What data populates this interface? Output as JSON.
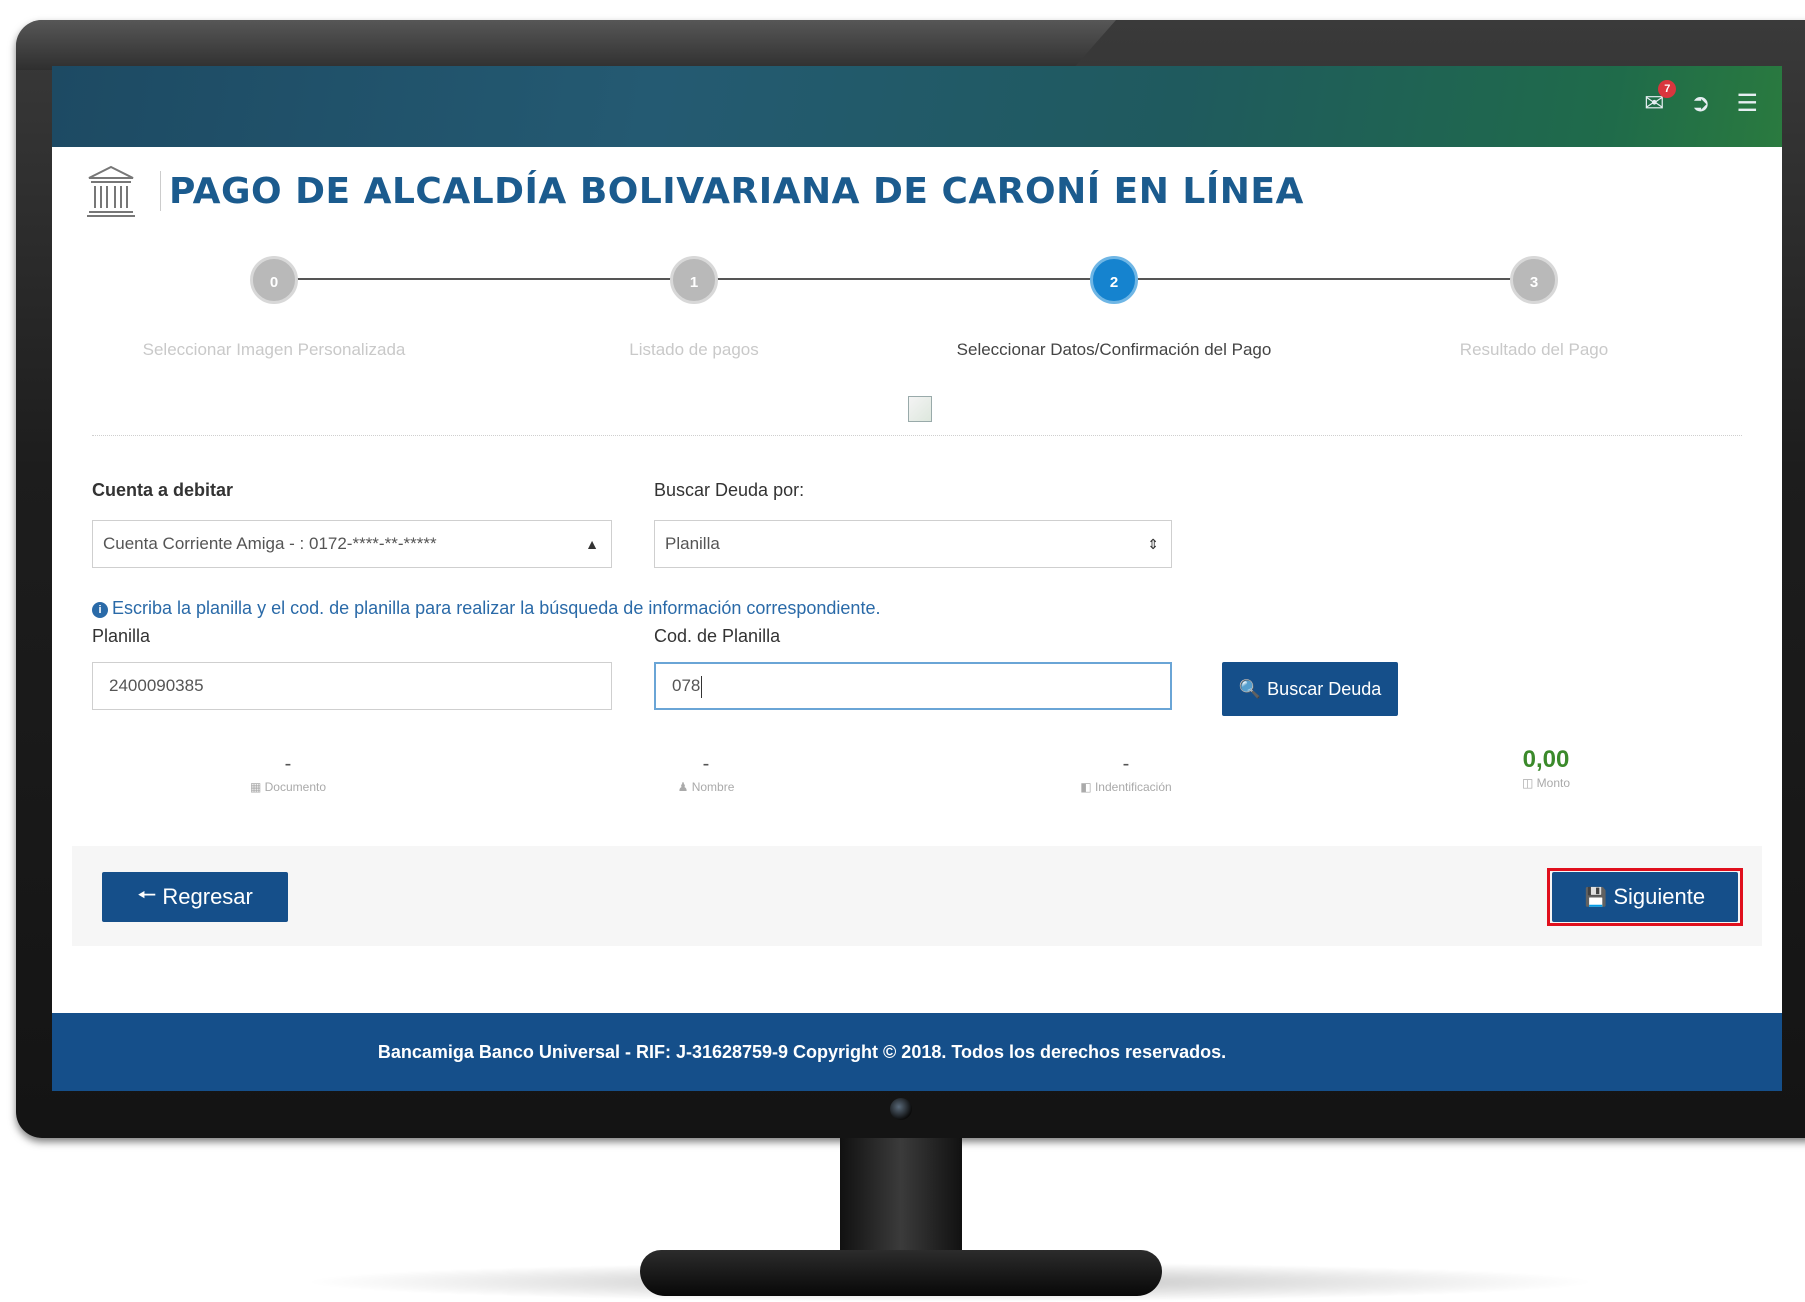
{
  "header": {
    "mail_badge": "7"
  },
  "page": {
    "title": "PAGO DE ALCALDÍA BOLIVARIANA DE CARONÍ EN LÍNEA"
  },
  "stepper": [
    {
      "number": "0",
      "label": "Seleccionar Imagen Personalizada",
      "active": false
    },
    {
      "number": "1",
      "label": "Listado de pagos",
      "active": false
    },
    {
      "number": "2",
      "label": "Seleccionar Datos/Confirmación del Pago",
      "active": true
    },
    {
      "number": "3",
      "label": "Resultado del Pago",
      "active": false
    }
  ],
  "form": {
    "cuenta_label": "Cuenta a debitar",
    "cuenta_value": "Cuenta Corriente Amiga - : 0172-****-**-*****",
    "buscar_label": "Buscar Deuda por:",
    "buscar_value": "Planilla",
    "hint": "Escriba la planilla y el cod. de planilla para realizar la búsqueda de información correspondiente.",
    "planilla_label": "Planilla",
    "planilla_value": "2400090385",
    "cod_label": "Cod. de Planilla",
    "cod_value": "078",
    "search_button": "Buscar Deuda"
  },
  "summary": {
    "documento": {
      "value": "-",
      "label": "Documento"
    },
    "nombre": {
      "value": "-",
      "label": "Nombre"
    },
    "identificacion": {
      "value": "-",
      "label": "Indentificación"
    },
    "monto": {
      "value": "0,00",
      "label": "Monto"
    }
  },
  "actions": {
    "back": "Regresar",
    "next": "Siguiente"
  },
  "footer": {
    "text": "Bancamiga Banco Universal - RIF: J-31628759-9 Copyright © 2018. Todos los derechos reservados."
  },
  "colors": {
    "primary": "#154f8a",
    "active_step": "#1583cf",
    "amount": "#3b8a2b",
    "highlight": "#e0101d"
  }
}
